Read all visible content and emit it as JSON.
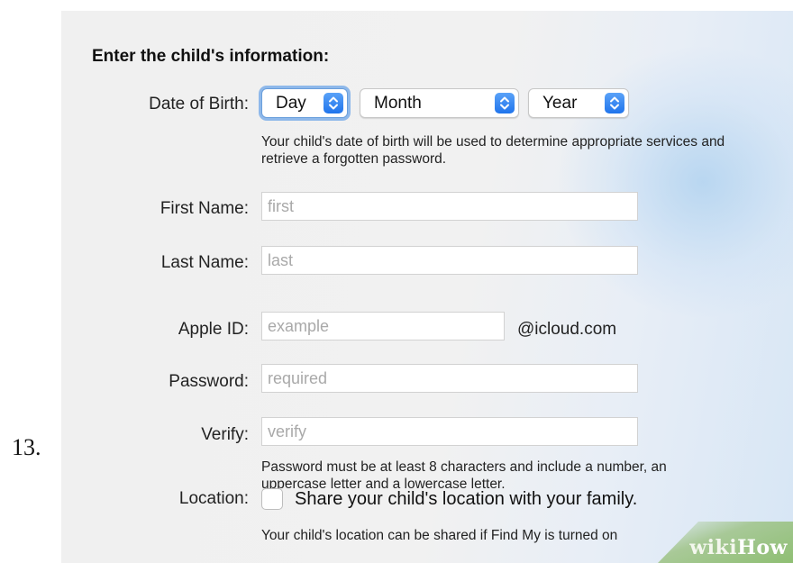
{
  "step_number": "13.",
  "heading": "Enter the child's information:",
  "dob": {
    "label": "Date of Birth:",
    "day": "Day",
    "month": "Month",
    "year": "Year",
    "help": "Your child's date of birth will be used to determine appropriate services and retrieve a forgotten password."
  },
  "first_name": {
    "label": "First Name:",
    "placeholder": "first"
  },
  "last_name": {
    "label": "Last Name:",
    "placeholder": "last"
  },
  "apple_id": {
    "label": "Apple ID:",
    "placeholder": "example",
    "suffix": "@icloud.com"
  },
  "password": {
    "label": "Password:",
    "placeholder": "required"
  },
  "verify": {
    "label": "Verify:",
    "placeholder": "verify",
    "help": "Password must be at least 8 characters and include a number, an uppercase letter and a lowercase letter."
  },
  "location": {
    "label": "Location:",
    "checkbox_label": "Share your child's location with your family.",
    "help": "Your child's location can be shared if Find My is turned on"
  },
  "watermark": {
    "part1": "wiki",
    "part2": "How"
  },
  "icons": {
    "stepper": "updown-chevron-icon"
  },
  "colors": {
    "accent": "#1f74ec",
    "focus_ring": "#8eb8ea"
  }
}
